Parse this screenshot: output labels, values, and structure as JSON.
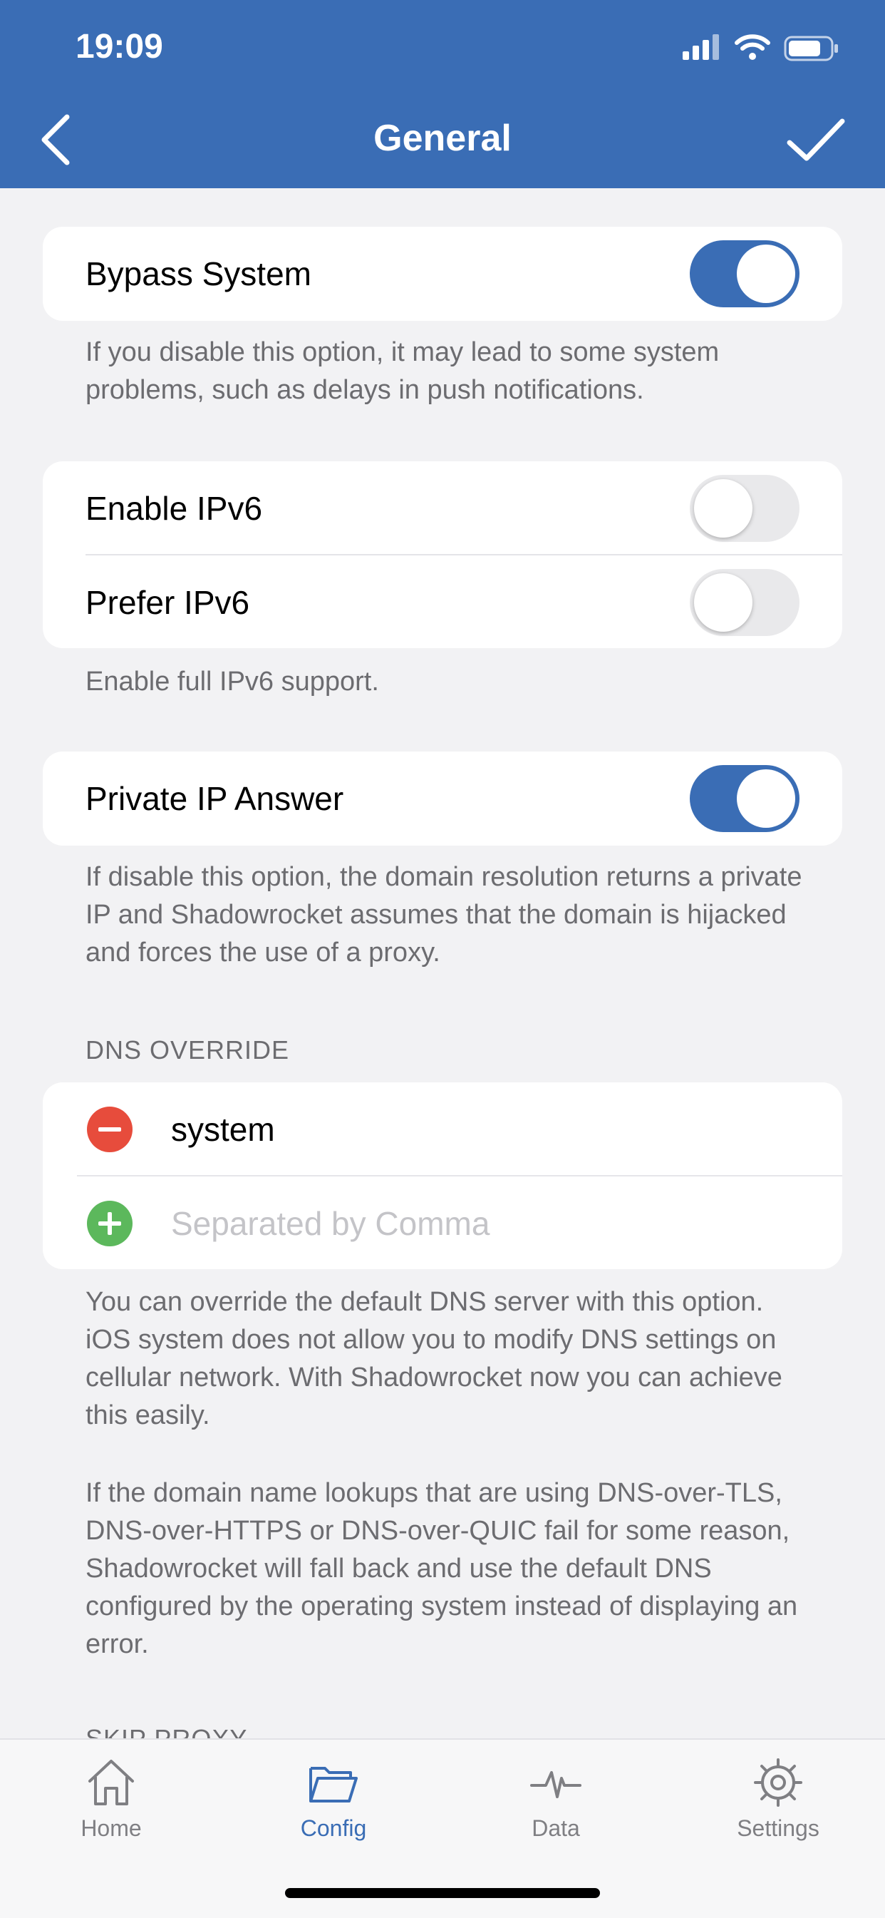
{
  "status_bar": {
    "time": "19:09"
  },
  "nav": {
    "title": "General",
    "back_icon": "chevron-left-icon",
    "done_icon": "checkmark-icon"
  },
  "bypass_system": {
    "label": "Bypass System",
    "enabled": true,
    "note": "If you disable this option, it may lead to some system problems, such as delays in push notifications."
  },
  "ipv6": {
    "enable_label": "Enable IPv6",
    "enable": false,
    "prefer_label": "Prefer IPv6",
    "prefer": false,
    "note": "Enable full IPv6 support."
  },
  "private_ip": {
    "label": "Private IP Answer",
    "enabled": true,
    "note": "If disable this option, the domain resolution returns a private IP and Shadowrocket assumes that the domain is hijacked and forces the use of a proxy."
  },
  "dns_override": {
    "header": "DNS OVERRIDE",
    "entry": "system",
    "input_value": "",
    "input_placeholder": "Separated by Comma",
    "note1": "You can override the default DNS server with this option. iOS system does not allow you to modify DNS settings on cellular network. With Shadowrocket now you can achieve this easily.",
    "note2": "If the domain name lookups that are using DNS-over-TLS, DNS-over-HTTPS or DNS-over-QUIC fail for some reason, Shadowrocket will fall back and use the default DNS configured by the operating system instead of displaying an error."
  },
  "next_section_header": "SKIP PROXY",
  "tabs": [
    {
      "label": "Home",
      "icon": "house-icon",
      "active": false
    },
    {
      "label": "Config",
      "icon": "folder-icon",
      "active": true
    },
    {
      "label": "Data",
      "icon": "activity-icon",
      "active": false
    },
    {
      "label": "Settings",
      "icon": "gear-icon",
      "active": false
    }
  ],
  "colors": {
    "accent": "#3a6db5",
    "remove": "#e74c3c",
    "add": "#5cb85c",
    "background": "#f2f2f4"
  }
}
